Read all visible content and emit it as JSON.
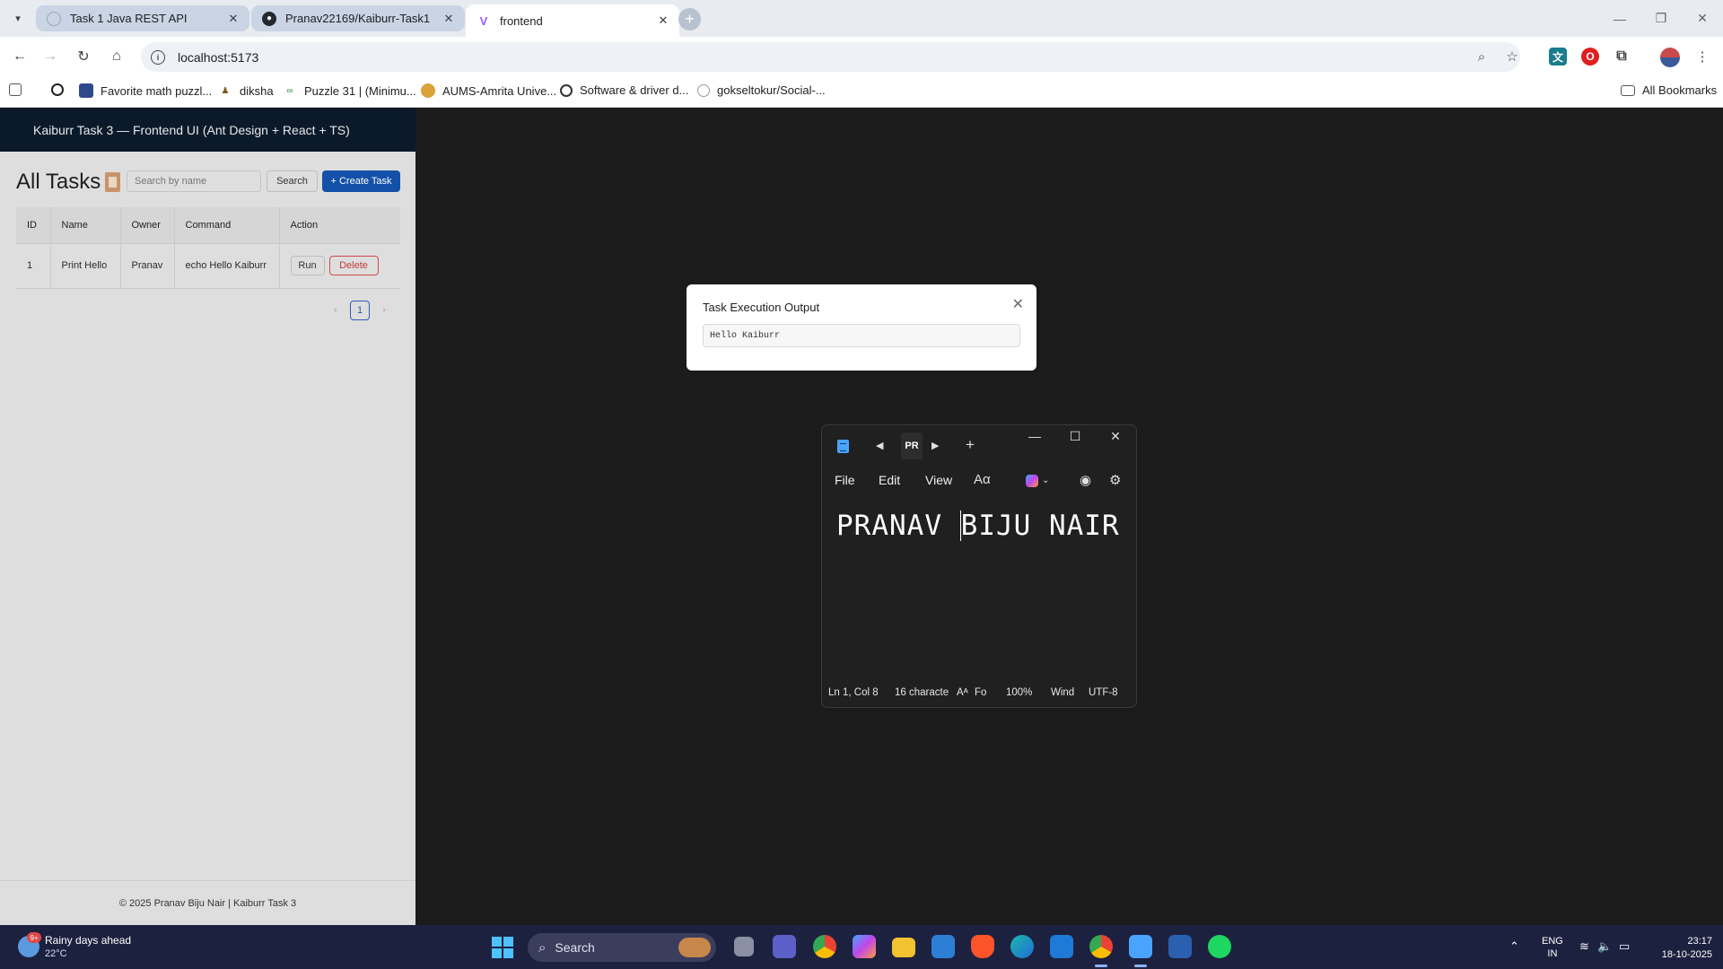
{
  "browser": {
    "tabs": [
      {
        "title": "Task 1 Java REST API",
        "active": false
      },
      {
        "title": "Pranav22169/Kaiburr-Task1",
        "active": false
      },
      {
        "title": "frontend",
        "active": true
      }
    ],
    "url": "localhost:5173",
    "bookmarks": [
      "Favorite math puzzl...",
      "diksha",
      "Puzzle 31 | (Minimu...",
      "AUMS-Amrita Unive...",
      "Software & driver d...",
      "gokseltokur/Social-..."
    ],
    "all_bookmarks": "All Bookmarks"
  },
  "app": {
    "header": "Kaiburr Task 3 — Frontend UI (Ant Design + React + TS)",
    "page_title": "All Tasks",
    "search_placeholder": "Search by name",
    "search_button": "Search",
    "create_button": "+ Create Task",
    "table": {
      "columns": [
        "ID",
        "Name",
        "Owner",
        "Command",
        "Action"
      ],
      "rows": [
        {
          "id": "1",
          "name": "Print Hello",
          "owner": "Pranav",
          "command": "echo Hello Kaiburr",
          "run": "Run",
          "delete": "Delete"
        }
      ]
    },
    "pagination": {
      "current": "1",
      "prev": "‹",
      "next": "›"
    },
    "footer": "© 2025 Pranav Biju Nair | Kaiburr Task 3"
  },
  "modal": {
    "title": "Task Execution Output",
    "output": "Hello Kaiburr",
    "close": "✕"
  },
  "notepad": {
    "tab_label": "PR",
    "menu": [
      "File",
      "Edit",
      "View"
    ],
    "text_before_caret": "PRANAV ",
    "text_after_caret": "BIJU NAIR",
    "status": {
      "position": "Ln 1, Col 8",
      "characters": "16 characte",
      "font": "Fo",
      "zoom": "100%",
      "line_ending": "Wind",
      "encoding": "UTF-8"
    }
  },
  "taskbar": {
    "weather_title": "Rainy days ahead",
    "weather_temp": "22°C",
    "weather_badge": "9+",
    "search_label": "Search",
    "lang_top": "ENG",
    "lang_bottom": "IN",
    "time": "23:17",
    "date": "18-10-2025"
  },
  "colors": {
    "primary": "#1350a8",
    "danger": "#c83a3a",
    "header_bg": "#0b1a2a",
    "taskbar_bg": "#1d2140"
  }
}
